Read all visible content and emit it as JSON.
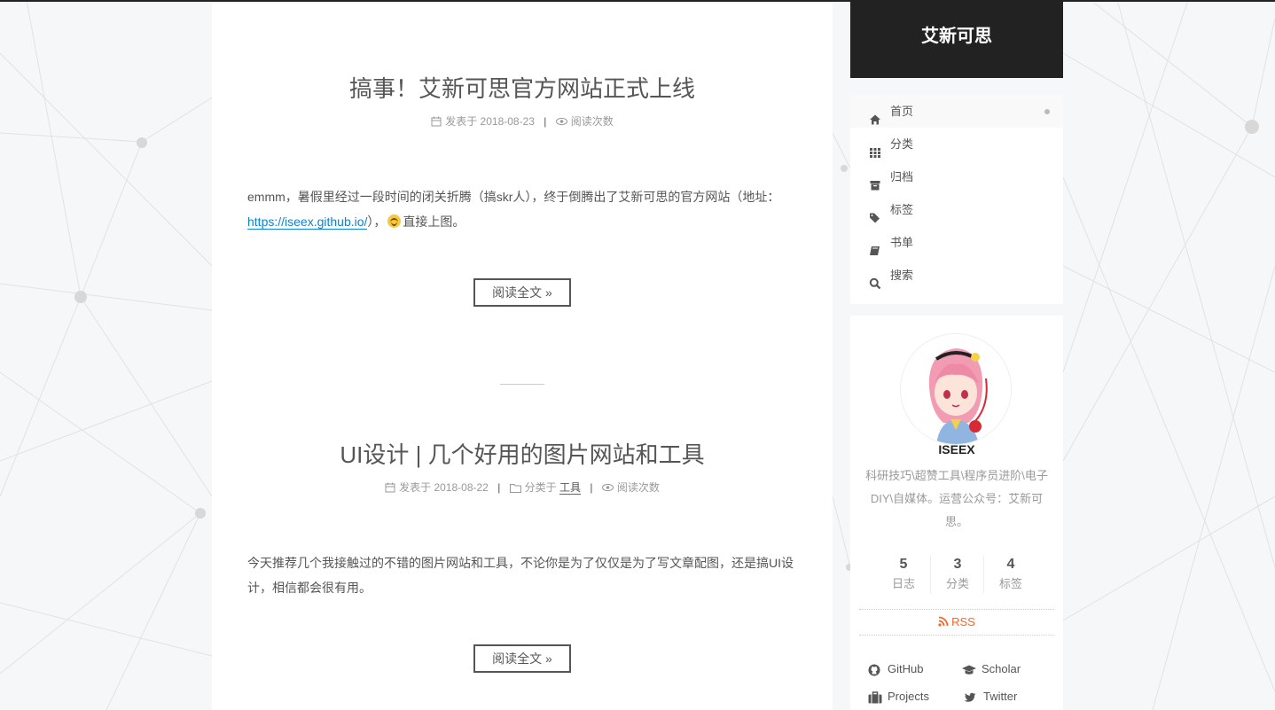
{
  "site": {
    "title": "艾新可思"
  },
  "menu": [
    {
      "label": "首页",
      "icon": "home-icon",
      "active": true
    },
    {
      "label": "分类",
      "icon": "th-grid-icon"
    },
    {
      "label": "归档",
      "icon": "archive-icon"
    },
    {
      "label": "标签",
      "icon": "tags-icon"
    },
    {
      "label": "书单",
      "icon": "book-icon"
    },
    {
      "label": "搜索",
      "icon": "search-icon"
    }
  ],
  "posts": [
    {
      "title": "搞事！艾新可思官方网站正式上线",
      "meta_posted": "发表于 2018-08-23",
      "meta_views": "阅读次数",
      "excerpt_text": "emmm，暑假里经过一段时间的闭关折腾（搞skr人），终于倒腾出了艾新可思的官方网站（地址：",
      "excerpt_link": "https://iseex.github.io/",
      "excerpt_after_link": "），",
      "excerpt_tail": "直接上图。",
      "read_more": "阅读全文 »"
    },
    {
      "title": "UI设计 | 几个好用的图片网站和工具",
      "meta_posted": "发表于 2018-08-22",
      "meta_category_prefix": "分类于",
      "meta_category": "工具",
      "meta_views": "阅读次数",
      "excerpt_text": "今天推荐几个我接触过的不错的图片网站和工具，不论你是为了仅仅是为了写文章配图，还是搞UI设计，相信都会很有用。",
      "read_more": "阅读全文 »"
    }
  ],
  "profile": {
    "name": "ISEEX",
    "description": "科研技巧\\超赞工具\\程序员进阶\\电子DIY\\自媒体。运营公众号：艾新可思。",
    "stats": [
      {
        "count": "5",
        "label": "日志"
      },
      {
        "count": "3",
        "label": "分类"
      },
      {
        "count": "4",
        "label": "标签"
      }
    ],
    "rss": "RSS",
    "links": [
      {
        "label": "GitHub",
        "icon": "github-icon"
      },
      {
        "label": "Scholar",
        "icon": "graduation-cap-icon"
      },
      {
        "label": "Projects",
        "icon": "briefcase-icon"
      },
      {
        "label": "Twitter",
        "icon": "twitter-icon"
      }
    ]
  },
  "colors": {
    "accent": "#222222",
    "link": "#0e83cd",
    "rss": "#fc6423"
  }
}
